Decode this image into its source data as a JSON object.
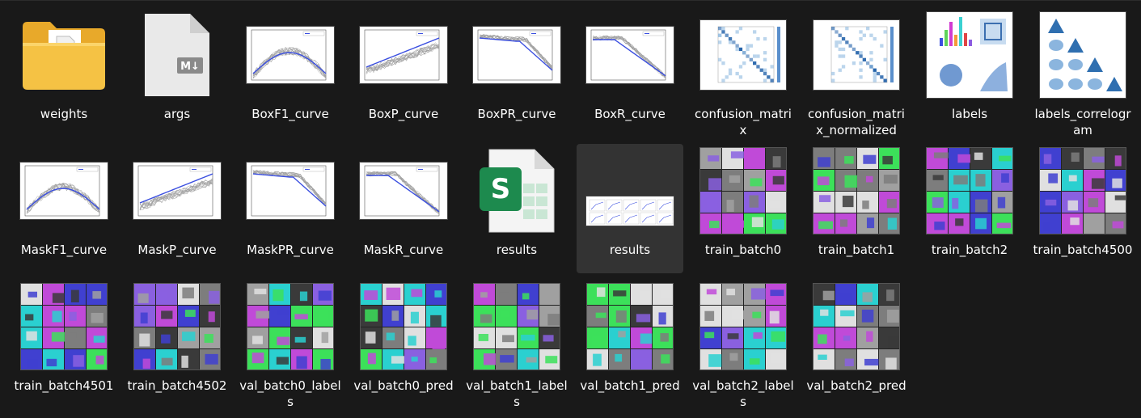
{
  "files": [
    {
      "name": "weights",
      "kind": "folder",
      "icon": "folder-icon"
    },
    {
      "name": "args",
      "kind": "markdown",
      "icon": "markdown-file-icon",
      "badge": "M↓"
    },
    {
      "name": "BoxF1_curve",
      "kind": "curve",
      "variant": "f1"
    },
    {
      "name": "BoxP_curve",
      "kind": "curve",
      "variant": "p"
    },
    {
      "name": "BoxPR_curve",
      "kind": "curve",
      "variant": "pr"
    },
    {
      "name": "BoxR_curve",
      "kind": "curve",
      "variant": "r"
    },
    {
      "name": "confusion_matrix",
      "kind": "matrix"
    },
    {
      "name": "confusion_matrix_normalized",
      "kind": "matrix"
    },
    {
      "name": "labels",
      "kind": "labels"
    },
    {
      "name": "labels_correlogram",
      "kind": "correlogram"
    },
    {
      "name": "MaskF1_curve",
      "kind": "curve",
      "variant": "f1"
    },
    {
      "name": "MaskP_curve",
      "kind": "curve",
      "variant": "p"
    },
    {
      "name": "MaskPR_curve",
      "kind": "curve",
      "variant": "pr"
    },
    {
      "name": "MaskR_curve",
      "kind": "curve",
      "variant": "r"
    },
    {
      "name": "results",
      "kind": "spreadsheet",
      "icon": "excel-csv-icon",
      "badge": "S"
    },
    {
      "name": "results",
      "kind": "results",
      "selected": true
    },
    {
      "name": "train_batch0",
      "kind": "batch"
    },
    {
      "name": "train_batch1",
      "kind": "batch"
    },
    {
      "name": "train_batch2",
      "kind": "batch"
    },
    {
      "name": "train_batch4500",
      "kind": "batch"
    },
    {
      "name": "train_batch4501",
      "kind": "batch"
    },
    {
      "name": "train_batch4502",
      "kind": "batch"
    },
    {
      "name": "val_batch0_labels",
      "kind": "batch"
    },
    {
      "name": "val_batch0_pred",
      "kind": "batch"
    },
    {
      "name": "val_batch1_labels",
      "kind": "batch"
    },
    {
      "name": "val_batch1_pred",
      "kind": "batch"
    },
    {
      "name": "val_batch2_labels",
      "kind": "batch"
    },
    {
      "name": "val_batch2_pred",
      "kind": "batch"
    }
  ],
  "colors": {
    "background": "#191919",
    "selected": "#333333",
    "folder": "#f5c244",
    "curve": "#3b4fe0",
    "excel": "#1d8a4e"
  }
}
